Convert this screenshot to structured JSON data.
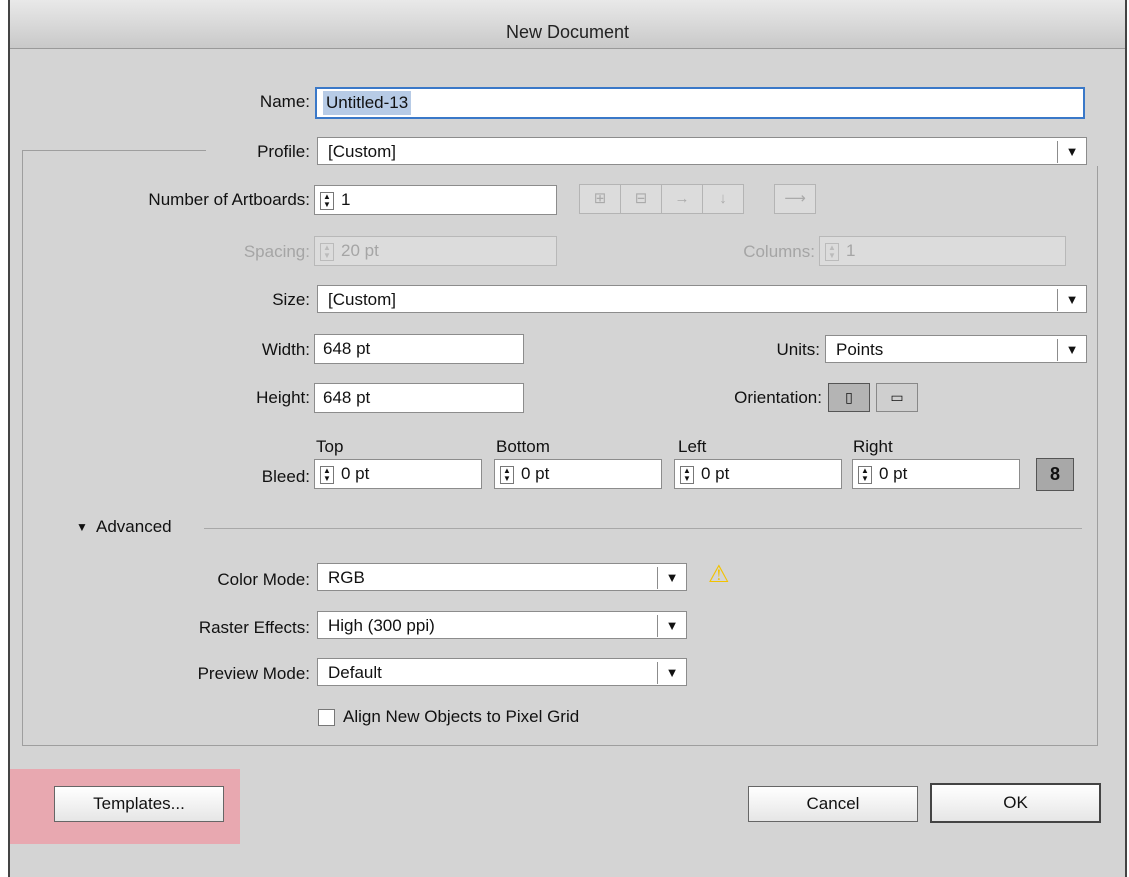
{
  "dialog": {
    "title": "New Document"
  },
  "name": {
    "label": "Name:",
    "value": "Untitled-13"
  },
  "profile": {
    "label": "Profile:",
    "value": "[Custom]"
  },
  "artboards": {
    "label": "Number of Artboards:",
    "value": "1",
    "layout_buttons": [
      "grid-by-row-icon",
      "grid-by-column-icon",
      "arrange-by-row-icon",
      "arrange-by-column-icon",
      "right-to-left-icon"
    ]
  },
  "spacing": {
    "label": "Spacing:",
    "value": "20 pt"
  },
  "columns": {
    "label": "Columns:",
    "value": "1"
  },
  "size": {
    "label": "Size:",
    "value": "[Custom]"
  },
  "width": {
    "label": "Width:",
    "value": "648 pt"
  },
  "height": {
    "label": "Height:",
    "value": "648 pt"
  },
  "units": {
    "label": "Units:",
    "value": "Points"
  },
  "orientation": {
    "label": "Orientation:",
    "selected": "portrait"
  },
  "bleed": {
    "label": "Bleed:",
    "top": {
      "label": "Top",
      "value": "0 pt"
    },
    "bottom": {
      "label": "Bottom",
      "value": "0 pt"
    },
    "left": {
      "label": "Left",
      "value": "0 pt"
    },
    "right": {
      "label": "Right",
      "value": "0 pt"
    }
  },
  "advanced": {
    "label": "Advanced",
    "expanded": true
  },
  "color_mode": {
    "label": "Color Mode:",
    "value": "RGB",
    "warning_icon": "warning-triangle-icon"
  },
  "raster_effects": {
    "label": "Raster Effects:",
    "value": "High (300 ppi)"
  },
  "preview_mode": {
    "label": "Preview Mode:",
    "value": "Default"
  },
  "pixel_grid": {
    "label": "Align New Objects to Pixel Grid",
    "checked": false
  },
  "buttons": {
    "templates": "Templates...",
    "cancel": "Cancel",
    "ok": "OK"
  },
  "colors": {
    "highlight": "#e8a8b0",
    "focus_ring": "#3a78c8",
    "warning": "#f2c200"
  }
}
